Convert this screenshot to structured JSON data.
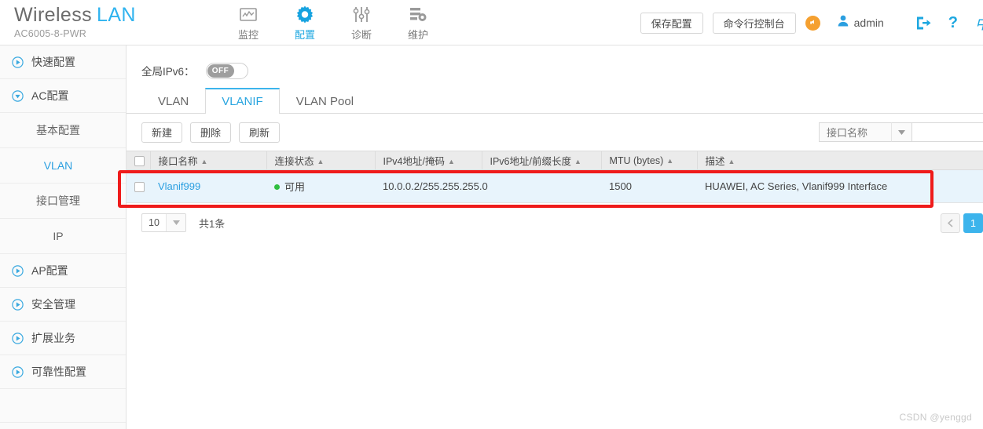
{
  "header": {
    "brand_name": "Wireless",
    "brand_accent": "LAN",
    "model": "AC6005-8-PWR",
    "nav": [
      {
        "label": "监控",
        "icon": "monitor-icon",
        "active": false
      },
      {
        "label": "配置",
        "icon": "gear-icon",
        "active": true
      },
      {
        "label": "诊断",
        "icon": "sliders-icon",
        "active": false
      },
      {
        "label": "维护",
        "icon": "maintenance-icon",
        "active": false
      }
    ],
    "save_config_label": "保存配置",
    "cli_console_label": "命令行控制台",
    "alarm_icon": "alarm-bell-icon",
    "user_icon": "user-icon",
    "user_name": "admin",
    "logout_icon": "logout-icon",
    "help_icon": "help-icon",
    "help_label": "?"
  },
  "sidebar": {
    "items": [
      {
        "label": "快速配置",
        "icon": "play-circle-icon",
        "type": "group",
        "expanded": false
      },
      {
        "label": "AC配置",
        "icon": "chevron-down-circle-icon",
        "type": "group",
        "expanded": true
      },
      {
        "label": "基本配置",
        "type": "sub",
        "active": false
      },
      {
        "label": "VLAN",
        "type": "sub",
        "active": true
      },
      {
        "label": "接口管理",
        "type": "sub",
        "active": false
      },
      {
        "label": "IP",
        "type": "sub",
        "active": false
      },
      {
        "label": "AP配置",
        "icon": "play-circle-icon",
        "type": "group",
        "expanded": false
      },
      {
        "label": "安全管理",
        "icon": "play-circle-icon",
        "type": "group",
        "expanded": false
      },
      {
        "label": "扩展业务",
        "icon": "play-circle-icon",
        "type": "group",
        "expanded": false
      },
      {
        "label": "可靠性配置",
        "icon": "play-circle-icon",
        "type": "group",
        "expanded": false
      }
    ]
  },
  "main": {
    "ipv6_label": "全局IPv6：",
    "ipv6_toggle_state": "OFF",
    "tabs": [
      {
        "label": "VLAN",
        "active": false
      },
      {
        "label": "VLANIF",
        "active": true
      },
      {
        "label": "VLAN Pool",
        "active": false
      }
    ],
    "toolbar": {
      "new_label": "新建",
      "delete_label": "删除",
      "refresh_label": "刷新"
    },
    "search": {
      "field_label": "接口名称",
      "input_value": "",
      "placeholder": ""
    },
    "table": {
      "columns": [
        "接口名称",
        "连接状态",
        "IPv4地址/掩码",
        "IPv6地址/前缀长度",
        "MTU (bytes)",
        "描述"
      ],
      "rows": [
        {
          "name": "Vlanif999",
          "status": "可用",
          "status_color": "#2fbe3f",
          "ipv4": "10.0.0.2/255.255.255.0",
          "ipv6": "",
          "mtu": "1500",
          "desc": "HUAWEI, AC Series, Vlanif999 Interface"
        }
      ]
    },
    "pager": {
      "page_size": "10",
      "total_text": "共1条",
      "prev_label": "‹",
      "current_page": "1"
    }
  },
  "watermark": "CSDN @yenggd"
}
